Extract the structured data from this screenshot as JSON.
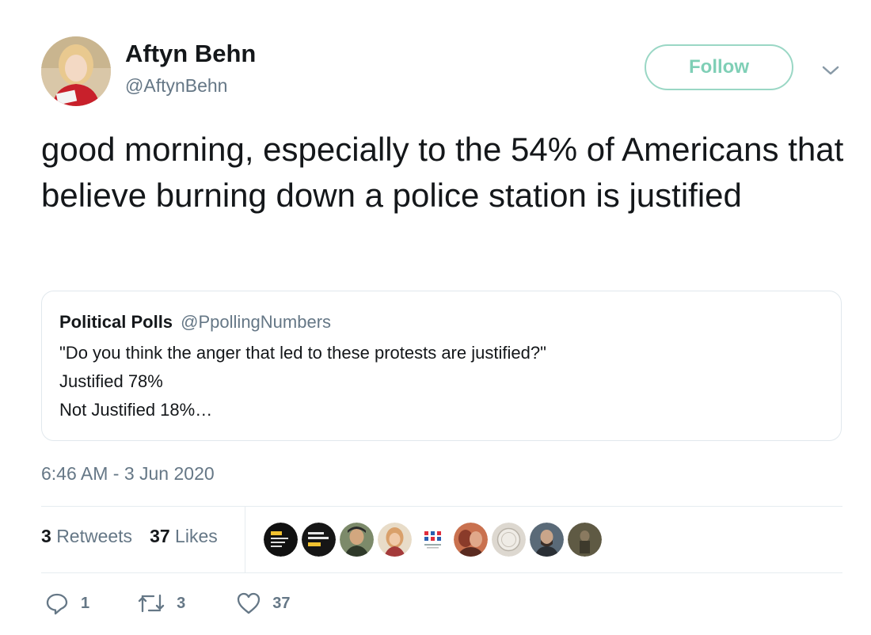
{
  "author": {
    "name": "Aftyn Behn",
    "handle": "@AftynBehn"
  },
  "follow_label": "Follow",
  "tweet_text": "good morning, especially to the 54% of Americans that believe burning down a police station is justified",
  "quoted_tweet": {
    "name": "Political Polls",
    "handle": "@PpollingNumbers",
    "lines": [
      "\"Do you think the anger that led to these protests are justified?\"",
      "Justified 78%",
      "Not Justified 18%…"
    ]
  },
  "timestamp": "6:46 AM - 3 Jun 2020",
  "stats": {
    "retweets_count": "3",
    "retweets_label": "Retweets",
    "likes_count": "37",
    "likes_label": "Likes"
  },
  "actions": {
    "reply_count": "1",
    "retweet_count": "3",
    "like_count": "37"
  },
  "colors": {
    "follow_accent": "#7fcfb6",
    "secondary_text": "#657786",
    "primary_text": "#14171a"
  }
}
